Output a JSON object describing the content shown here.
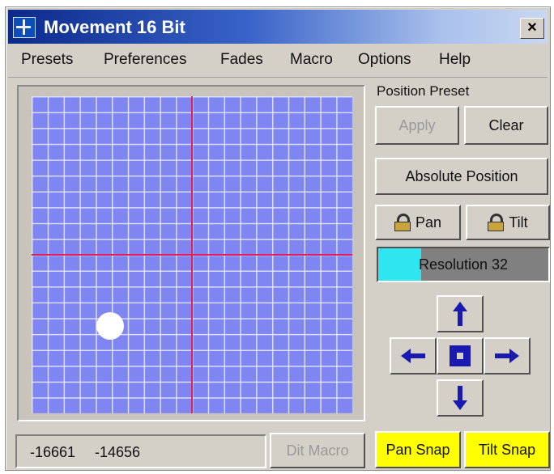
{
  "window": {
    "title": "Movement 16 Bit",
    "close_glyph": "×"
  },
  "menu": {
    "items": [
      "Presets",
      "Preferences",
      "Fades",
      "Macro",
      "Options",
      "Help"
    ]
  },
  "grid": {
    "background_color": "#7f86f2",
    "crosshair_color": "#e0205a",
    "marker_color": "#ffffff",
    "marker_position": {
      "pan": -16661,
      "tilt": -14656
    },
    "axis_range": [
      -32768,
      32767
    ]
  },
  "position_preset": {
    "label": "Position Preset",
    "apply_label": "Apply",
    "apply_enabled": false,
    "clear_label": "Clear"
  },
  "absolute_position_label": "Absolute Position",
  "locks": {
    "pan_label": "Pan",
    "tilt_label": "Tilt",
    "icon": "lock-icon"
  },
  "resolution": {
    "label": "Resolution 32",
    "fill_fraction": 0.25,
    "fill_color": "#2ee6f0"
  },
  "nudge_pad": {
    "up_icon": "arrow-up-icon",
    "down_icon": "arrow-down-icon",
    "left_icon": "arrow-left-icon",
    "right_icon": "arrow-right-icon",
    "center_icon": "center-icon",
    "arrow_color": "#1a1ab0"
  },
  "status": {
    "pan_value": "-16661",
    "tilt_value": "-14656"
  },
  "edit_macro_label": "Dit Macro",
  "snap": {
    "pan_label": "Pan Snap",
    "tilt_label": "Tilt Snap",
    "color": "#ffff00"
  }
}
